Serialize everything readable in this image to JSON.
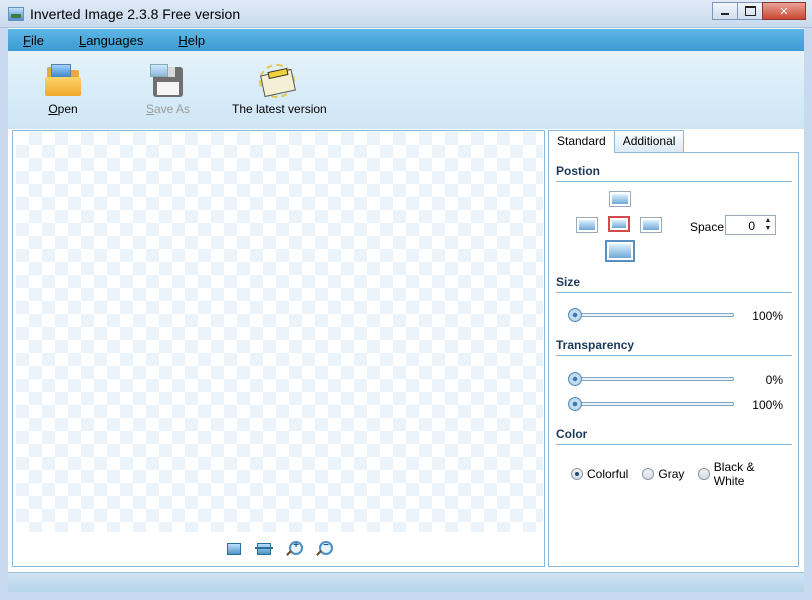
{
  "window": {
    "title": "Inverted Image 2.3.8 Free version",
    "icons": {
      "minimize": "minimize-icon",
      "maximize": "maximize-icon",
      "close": "close-icon",
      "close_glyph": "✕"
    }
  },
  "menu": {
    "file_u": "F",
    "file_rest": "ile",
    "languages_u": "L",
    "languages_rest": "anguages",
    "help_u": "H",
    "help_rest": "elp"
  },
  "toolbar": {
    "open_u": "O",
    "open_rest": "pen",
    "save_as_u": "S",
    "save_as_rest": "ave As",
    "latest_label": "The latest version",
    "icons": {
      "open": "folder-open-icon",
      "save_as": "floppy-disk-icon",
      "latest": "extra-newspaper-icon"
    }
  },
  "canvas": {
    "tools": [
      "zoom-fit-icon",
      "actual-size-icon",
      "zoom-in-icon",
      "zoom-out-icon"
    ],
    "zoom_in_glyph": "+",
    "zoom_out_glyph": "−"
  },
  "side_panel": {
    "tabs": [
      "Standard",
      "Additional"
    ],
    "active_tab": "Standard",
    "position": {
      "title": "Postion",
      "selected": "center",
      "space_label": "Space",
      "space_value": "0",
      "spin_up": "▲",
      "spin_down": "▼"
    },
    "size": {
      "title": "Size",
      "value": 1.0,
      "label": "100%"
    },
    "transparency": {
      "title": "Transparency",
      "start_value": 0.0,
      "start_label": "0%",
      "end_value": 1.0,
      "end_label": "100%"
    },
    "color": {
      "title": "Color",
      "options": [
        "Colorful",
        "Gray",
        "Black & White"
      ],
      "selected": "Colorful"
    }
  }
}
